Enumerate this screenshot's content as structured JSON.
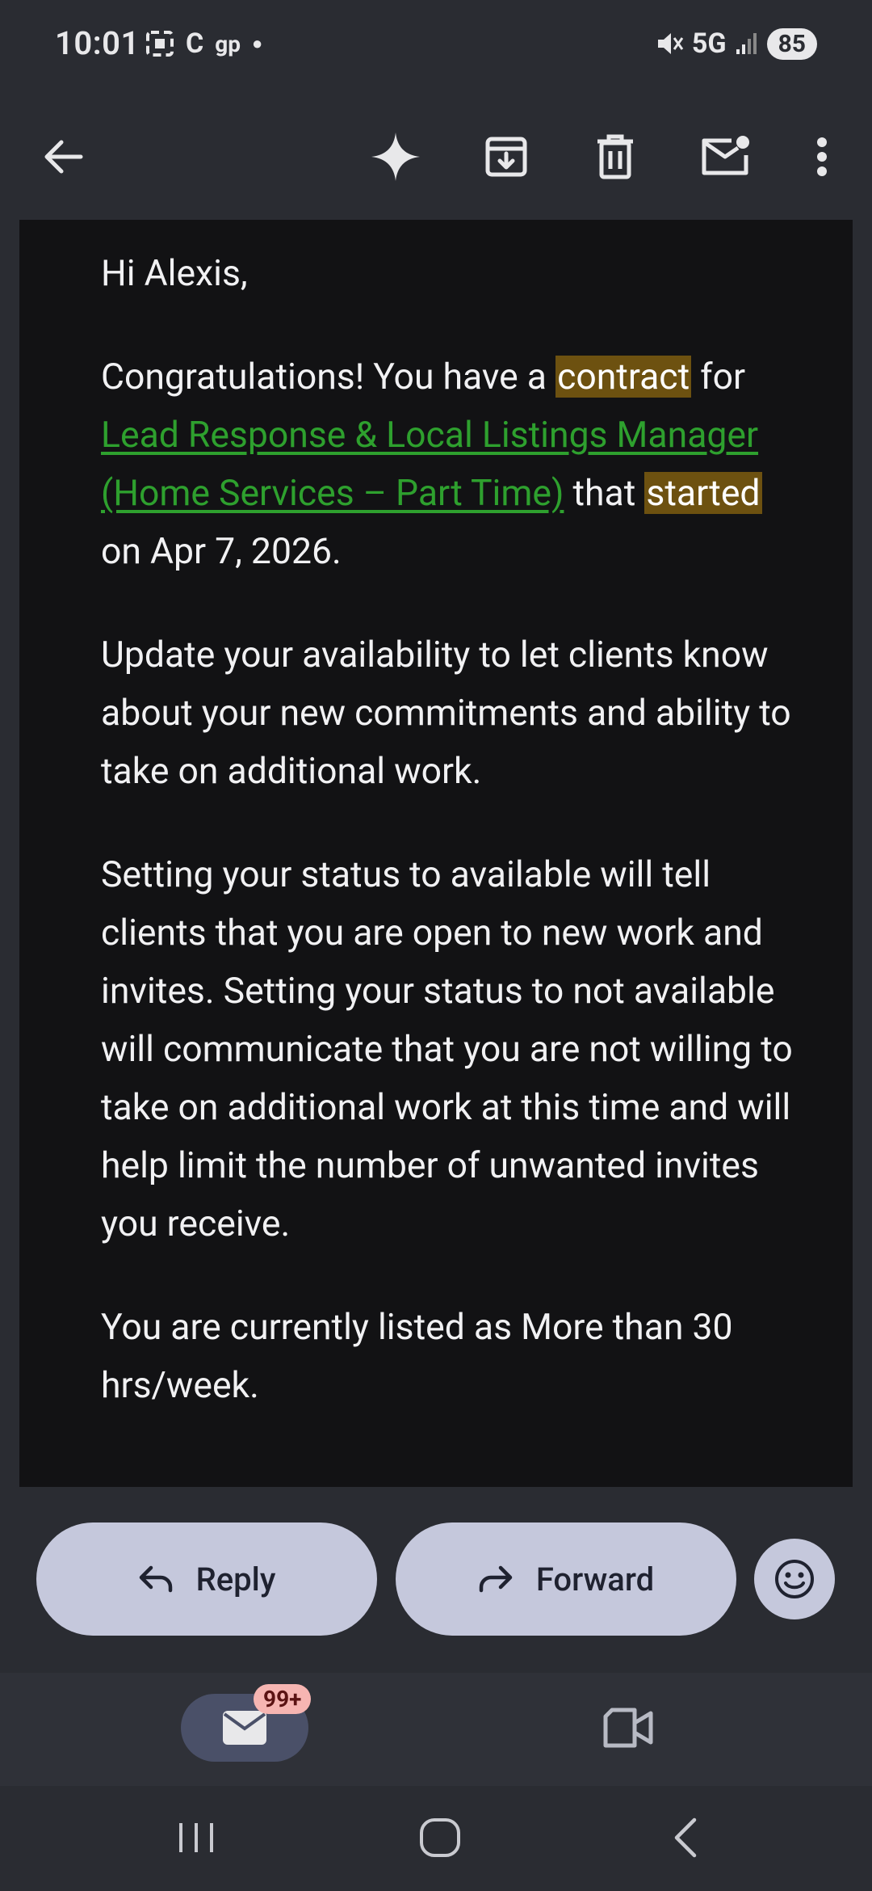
{
  "status_bar": {
    "time": "10:01",
    "carrier_icons": [
      "C",
      "gp"
    ],
    "network": "5G",
    "battery": "85"
  },
  "toolbar": {
    "back_icon": "arrow-left-icon",
    "actions": [
      "sparkle-icon",
      "archive-icon",
      "trash-icon",
      "mark-unread-icon",
      "more-vert-icon"
    ]
  },
  "email": {
    "greeting": "Hi Alexis,",
    "p1_a": "Congratulations! You have a ",
    "p1_hl1": "contract",
    "p1_b": " for ",
    "p1_link": "Lead Response & Local Listings Manager (Home Services – Part Time)",
    "p1_c": " that ",
    "p1_hl2": "started",
    "p1_d": " on Apr 7, 2026.",
    "p2": "Update your availability to let clients know about your new commitments and ability to take on additional work.",
    "p3": "Setting your status to available will tell clients that you are open to new work and invites. Setting your status to not available will communicate that you are not willing to take on additional work at this time and will help limit the number of unwanted invites you receive.",
    "p4": "You are currently listed as More than 30 hrs/week."
  },
  "actions": {
    "reply": "Reply",
    "forward": "Forward"
  },
  "bottom_nav": {
    "mail_badge": "99+"
  },
  "colors": {
    "highlight": "#6d5110",
    "link": "#2ea02e",
    "pill": "#c5c8dc",
    "background": "#2a2c32"
  }
}
